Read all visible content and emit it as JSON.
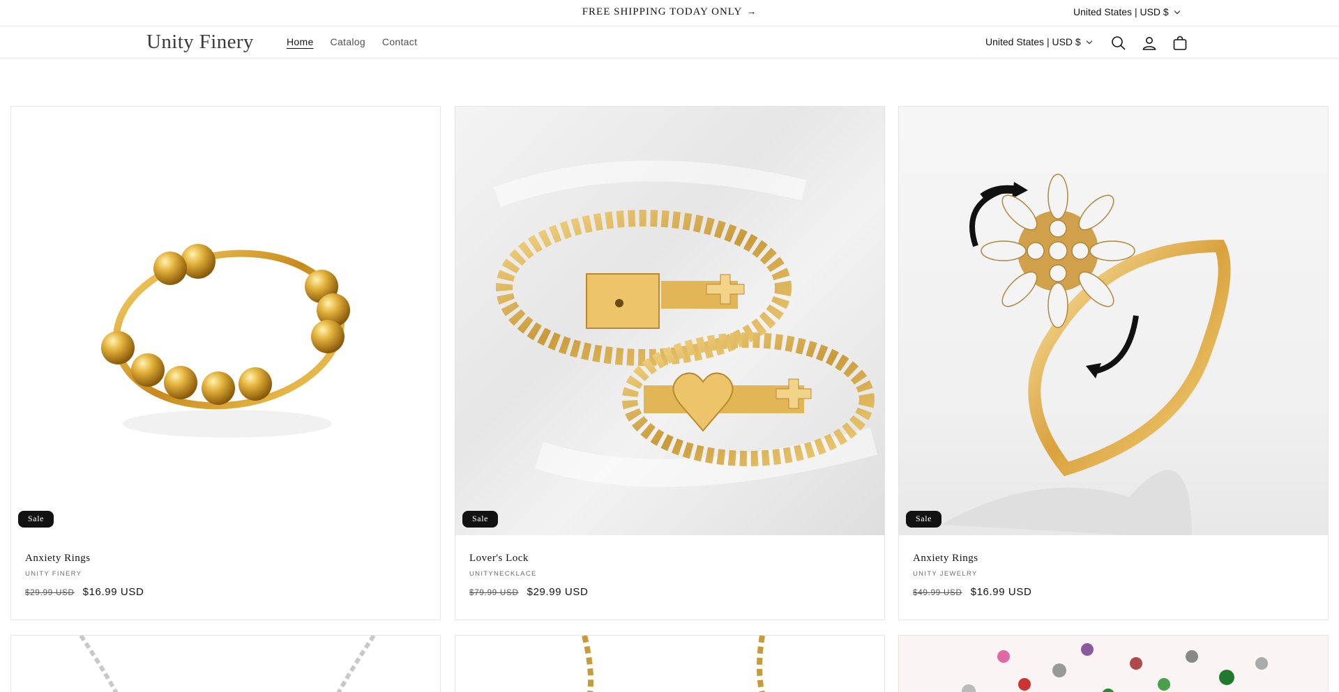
{
  "announcement": {
    "text": "FREE SHIPPING TODAY ONLY",
    "arrow": "→",
    "locale": "United States | USD $"
  },
  "header": {
    "logo": "Unity Finery",
    "nav": [
      {
        "label": "Home"
      },
      {
        "label": "Catalog"
      },
      {
        "label": "Contact"
      }
    ],
    "locale": "United States | USD $",
    "icons": [
      "search-icon",
      "account-icon",
      "cart-icon"
    ]
  },
  "products": [
    {
      "badge": "Sale",
      "title": "Anxiety Rings",
      "vendor": "UNITY FINERY",
      "compare_price": "$29.99 USD",
      "price": "$16.99 USD",
      "image": "gold-bead-spinner-ring"
    },
    {
      "badge": "Sale",
      "title": "Lover's Lock",
      "vendor": "UNITYNECKLACE",
      "compare_price": "$79.99 USD",
      "price": "$29.99 USD",
      "image": "gold-lock-bracelets"
    },
    {
      "badge": "Sale",
      "title": "Anxiety Rings",
      "vendor": "UNITY JEWELRY",
      "compare_price": "$49.99 USD",
      "price": "$16.99 USD",
      "image": "gold-flower-spinner-ring"
    },
    {
      "image": "silver-chain-necklace"
    },
    {
      "image": "gold-chain-necklace"
    },
    {
      "image": "charms-assortment"
    }
  ],
  "colors": {
    "badge_bg": "#121212",
    "border": "#e4e4e4",
    "text": "#121212"
  }
}
